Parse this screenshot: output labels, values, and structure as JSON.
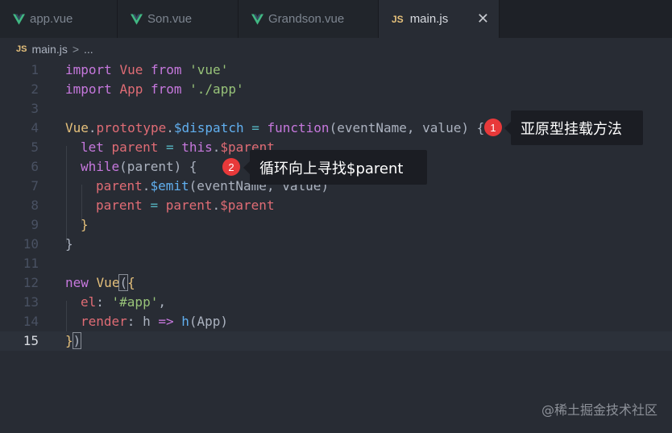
{
  "tabs": [
    {
      "label": "app.vue",
      "icon": "vue-icon"
    },
    {
      "label": "Son.vue",
      "icon": "vue-icon"
    },
    {
      "label": "Grandson.vue",
      "icon": "vue-icon"
    },
    {
      "label": "main.js",
      "icon": "js-icon",
      "icon_text": "JS",
      "active": true,
      "close": "✕"
    }
  ],
  "breadcrumb": {
    "file": "main.js",
    "icon_text": "JS",
    "separator": ">",
    "more": "..."
  },
  "lines": [
    "1",
    "2",
    "3",
    "4",
    "5",
    "6",
    "7",
    "8",
    "9",
    "10",
    "11",
    "12",
    "13",
    "14",
    "15"
  ],
  "code": {
    "l1": [
      "import",
      " ",
      "Vue",
      " ",
      "from",
      " ",
      "'vue'"
    ],
    "l2": [
      "import",
      " ",
      "App",
      " ",
      "from",
      " ",
      "'./app'"
    ],
    "l4": [
      "Vue",
      ".",
      "prototype",
      ".",
      "$dispatch",
      " = ",
      "function",
      "(",
      "eventName, value",
      ") {"
    ],
    "l5": [
      "let",
      " parent ",
      "= ",
      "this",
      ".",
      "$parent"
    ],
    "l6": [
      "while",
      "(parent) {"
    ],
    "l7": [
      "parent",
      ".",
      "$emit",
      "(eventName, value)"
    ],
    "l8": [
      "parent ",
      "= ",
      "parent",
      ".",
      "$parent"
    ],
    "l9": [
      "}"
    ],
    "l10": [
      "}"
    ],
    "l12": [
      "new",
      " ",
      "Vue",
      "(",
      "{"
    ],
    "l13": [
      "el",
      ": ",
      "'#app'",
      ","
    ],
    "l14": [
      "render",
      ": h ",
      "=>",
      " ",
      "h",
      "(App)"
    ],
    "l15": [
      "}",
      ")"
    ]
  },
  "annotations": [
    {
      "number": "1",
      "text": "亚原型挂载方法"
    },
    {
      "number": "2",
      "text": "循环向上寻找$parent"
    }
  ],
  "watermark": "@稀土掘金技术社区",
  "colors": {
    "keyword": "#c678dd",
    "class": "#e5c07b",
    "string": "#98c379",
    "function": "#61afef",
    "variable": "#e06c75",
    "badge": "#e8393a",
    "vue_icon": "#41b883"
  }
}
